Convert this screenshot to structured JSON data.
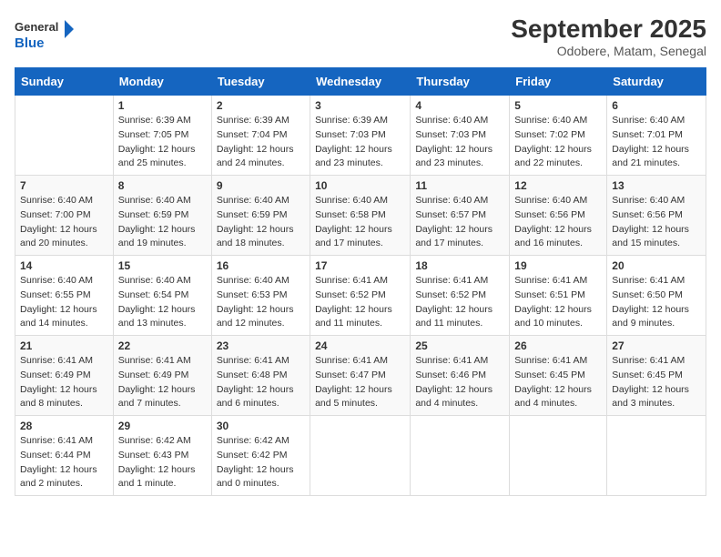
{
  "logo": {
    "general": "General",
    "blue": "Blue"
  },
  "title": {
    "month_year": "September 2025",
    "location": "Odobere, Matam, Senegal"
  },
  "days_of_week": [
    "Sunday",
    "Monday",
    "Tuesday",
    "Wednesday",
    "Thursday",
    "Friday",
    "Saturday"
  ],
  "weeks": [
    [
      {
        "day": "",
        "detail": ""
      },
      {
        "day": "1",
        "detail": "Sunrise: 6:39 AM\nSunset: 7:05 PM\nDaylight: 12 hours\nand 25 minutes."
      },
      {
        "day": "2",
        "detail": "Sunrise: 6:39 AM\nSunset: 7:04 PM\nDaylight: 12 hours\nand 24 minutes."
      },
      {
        "day": "3",
        "detail": "Sunrise: 6:39 AM\nSunset: 7:03 PM\nDaylight: 12 hours\nand 23 minutes."
      },
      {
        "day": "4",
        "detail": "Sunrise: 6:40 AM\nSunset: 7:03 PM\nDaylight: 12 hours\nand 23 minutes."
      },
      {
        "day": "5",
        "detail": "Sunrise: 6:40 AM\nSunset: 7:02 PM\nDaylight: 12 hours\nand 22 minutes."
      },
      {
        "day": "6",
        "detail": "Sunrise: 6:40 AM\nSunset: 7:01 PM\nDaylight: 12 hours\nand 21 minutes."
      }
    ],
    [
      {
        "day": "7",
        "detail": "Sunrise: 6:40 AM\nSunset: 7:00 PM\nDaylight: 12 hours\nand 20 minutes."
      },
      {
        "day": "8",
        "detail": "Sunrise: 6:40 AM\nSunset: 6:59 PM\nDaylight: 12 hours\nand 19 minutes."
      },
      {
        "day": "9",
        "detail": "Sunrise: 6:40 AM\nSunset: 6:59 PM\nDaylight: 12 hours\nand 18 minutes."
      },
      {
        "day": "10",
        "detail": "Sunrise: 6:40 AM\nSunset: 6:58 PM\nDaylight: 12 hours\nand 17 minutes."
      },
      {
        "day": "11",
        "detail": "Sunrise: 6:40 AM\nSunset: 6:57 PM\nDaylight: 12 hours\nand 17 minutes."
      },
      {
        "day": "12",
        "detail": "Sunrise: 6:40 AM\nSunset: 6:56 PM\nDaylight: 12 hours\nand 16 minutes."
      },
      {
        "day": "13",
        "detail": "Sunrise: 6:40 AM\nSunset: 6:56 PM\nDaylight: 12 hours\nand 15 minutes."
      }
    ],
    [
      {
        "day": "14",
        "detail": "Sunrise: 6:40 AM\nSunset: 6:55 PM\nDaylight: 12 hours\nand 14 minutes."
      },
      {
        "day": "15",
        "detail": "Sunrise: 6:40 AM\nSunset: 6:54 PM\nDaylight: 12 hours\nand 13 minutes."
      },
      {
        "day": "16",
        "detail": "Sunrise: 6:40 AM\nSunset: 6:53 PM\nDaylight: 12 hours\nand 12 minutes."
      },
      {
        "day": "17",
        "detail": "Sunrise: 6:41 AM\nSunset: 6:52 PM\nDaylight: 12 hours\nand 11 minutes."
      },
      {
        "day": "18",
        "detail": "Sunrise: 6:41 AM\nSunset: 6:52 PM\nDaylight: 12 hours\nand 11 minutes."
      },
      {
        "day": "19",
        "detail": "Sunrise: 6:41 AM\nSunset: 6:51 PM\nDaylight: 12 hours\nand 10 minutes."
      },
      {
        "day": "20",
        "detail": "Sunrise: 6:41 AM\nSunset: 6:50 PM\nDaylight: 12 hours\nand 9 minutes."
      }
    ],
    [
      {
        "day": "21",
        "detail": "Sunrise: 6:41 AM\nSunset: 6:49 PM\nDaylight: 12 hours\nand 8 minutes."
      },
      {
        "day": "22",
        "detail": "Sunrise: 6:41 AM\nSunset: 6:49 PM\nDaylight: 12 hours\nand 7 minutes."
      },
      {
        "day": "23",
        "detail": "Sunrise: 6:41 AM\nSunset: 6:48 PM\nDaylight: 12 hours\nand 6 minutes."
      },
      {
        "day": "24",
        "detail": "Sunrise: 6:41 AM\nSunset: 6:47 PM\nDaylight: 12 hours\nand 5 minutes."
      },
      {
        "day": "25",
        "detail": "Sunrise: 6:41 AM\nSunset: 6:46 PM\nDaylight: 12 hours\nand 4 minutes."
      },
      {
        "day": "26",
        "detail": "Sunrise: 6:41 AM\nSunset: 6:45 PM\nDaylight: 12 hours\nand 4 minutes."
      },
      {
        "day": "27",
        "detail": "Sunrise: 6:41 AM\nSunset: 6:45 PM\nDaylight: 12 hours\nand 3 minutes."
      }
    ],
    [
      {
        "day": "28",
        "detail": "Sunrise: 6:41 AM\nSunset: 6:44 PM\nDaylight: 12 hours\nand 2 minutes."
      },
      {
        "day": "29",
        "detail": "Sunrise: 6:42 AM\nSunset: 6:43 PM\nDaylight: 12 hours\nand 1 minute."
      },
      {
        "day": "30",
        "detail": "Sunrise: 6:42 AM\nSunset: 6:42 PM\nDaylight: 12 hours\nand 0 minutes."
      },
      {
        "day": "",
        "detail": ""
      },
      {
        "day": "",
        "detail": ""
      },
      {
        "day": "",
        "detail": ""
      },
      {
        "day": "",
        "detail": ""
      }
    ]
  ]
}
